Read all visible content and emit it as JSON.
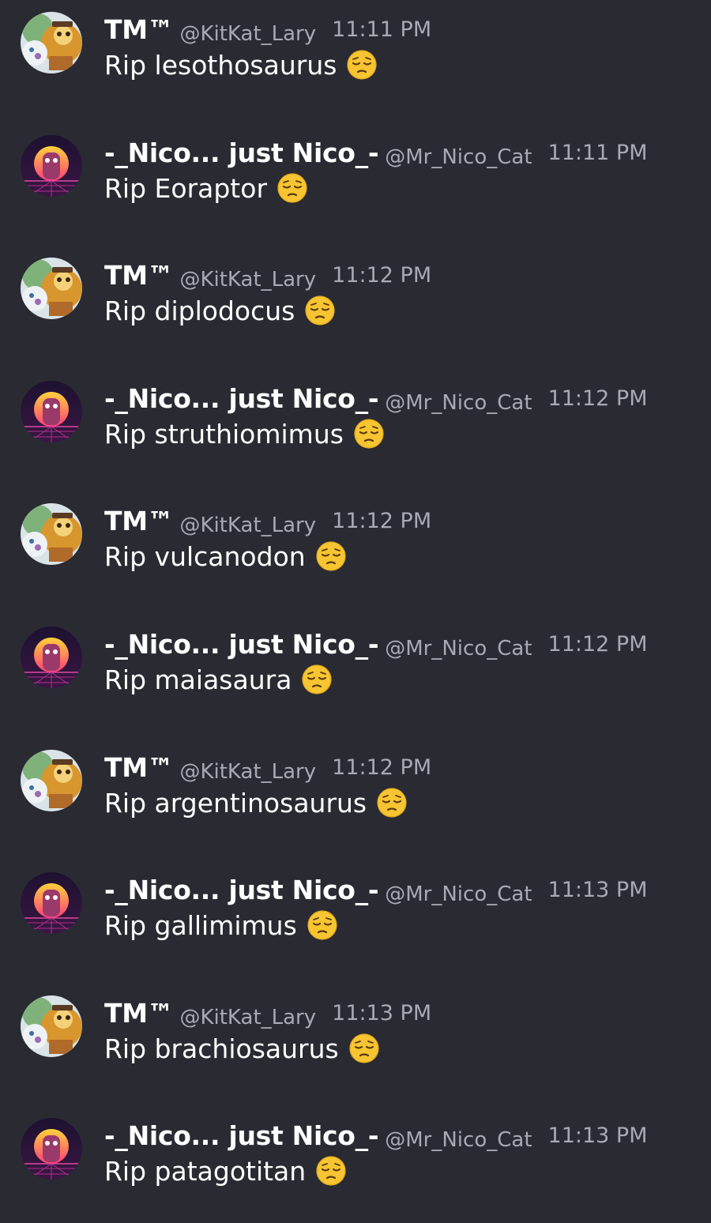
{
  "messages": [
    {
      "author": "TM™",
      "handle": "@KitKat_Lary",
      "time": "11:11 PM",
      "text": "Rip lesothosaurus",
      "emoji": "pensive-face-icon",
      "avatar": "tm"
    },
    {
      "author": "-_Nico... just Nico_-",
      "handle": "@Mr_Nico_Cat",
      "time": "11:11 PM",
      "text": "Rip Eoraptor",
      "emoji": "pensive-face-icon",
      "avatar": "nico"
    },
    {
      "author": "TM™",
      "handle": "@KitKat_Lary",
      "time": "11:12 PM",
      "text": "Rip diplodocus",
      "emoji": "pensive-face-icon",
      "avatar": "tm"
    },
    {
      "author": "-_Nico... just Nico_-",
      "handle": "@Mr_Nico_Cat",
      "time": "11:12 PM",
      "text": "Rip struthiomimus",
      "emoji": "pensive-face-icon",
      "avatar": "nico"
    },
    {
      "author": "TM™",
      "handle": "@KitKat_Lary",
      "time": "11:12 PM",
      "text": "Rip vulcanodon",
      "emoji": "pensive-face-icon",
      "avatar": "tm"
    },
    {
      "author": "-_Nico... just Nico_-",
      "handle": "@Mr_Nico_Cat",
      "time": "11:12 PM",
      "text": "Rip maiasaura",
      "emoji": "pensive-face-icon",
      "avatar": "nico"
    },
    {
      "author": "TM™",
      "handle": "@KitKat_Lary",
      "time": "11:12 PM",
      "text": "Rip argentinosaurus",
      "emoji": "pensive-face-icon",
      "avatar": "tm"
    },
    {
      "author": "-_Nico... just Nico_-",
      "handle": "@Mr_Nico_Cat",
      "time": "11:13 PM",
      "text": "Rip gallimimus",
      "emoji": "pensive-face-icon",
      "avatar": "nico"
    },
    {
      "author": "TM™",
      "handle": "@KitKat_Lary",
      "time": "11:13 PM",
      "text": "Rip brachiosaurus",
      "emoji": "pensive-face-icon",
      "avatar": "tm"
    },
    {
      "author": "-_Nico... just Nico_-",
      "handle": "@Mr_Nico_Cat",
      "time": "11:13 PM",
      "text": "Rip patagotitan",
      "emoji": "pensive-face-icon",
      "avatar": "nico"
    }
  ],
  "colors": {
    "background": "#2a2a33",
    "name": "#ffffff",
    "meta": "#a9a9b3",
    "emoji": "#f7c531"
  }
}
